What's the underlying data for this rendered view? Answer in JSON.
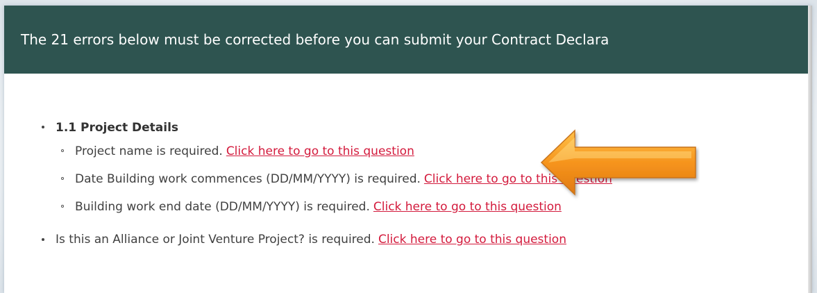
{
  "banner": {
    "text": "The 21 errors below must be corrected before you can submit your Contract Declara"
  },
  "errors": {
    "section_title": "1.1 Project Details",
    "items": [
      {
        "text": "Project name is required.",
        "link": "Click here to go to this question"
      },
      {
        "text": "Date Building work commences (DD/MM/YYYY) is required.",
        "link": "Click here to go to this question"
      },
      {
        "text": "Building work end date (DD/MM/YYYY) is required.",
        "link": "Click here to go to this question"
      }
    ],
    "top_item": {
      "text": "Is this an Alliance or Joint Venture Project? is required.",
      "link": "Click here to go to this question"
    }
  },
  "annotation": {
    "arrow_icon": "orange-arrow-left-icon",
    "arrow_color": "#f39a1e"
  },
  "colors": {
    "banner_bg": "#2e5450",
    "link": "#d31a3c"
  }
}
